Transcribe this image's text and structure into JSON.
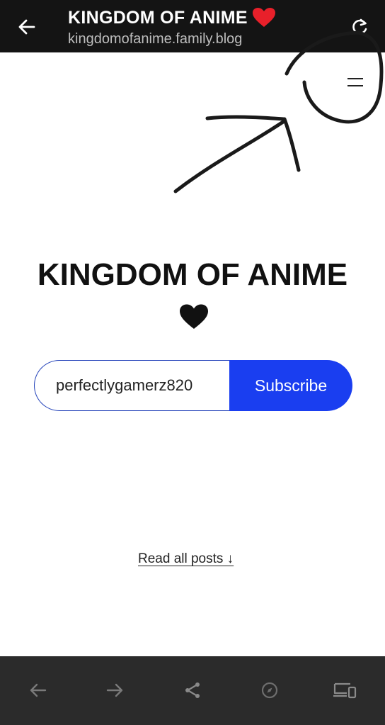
{
  "browser": {
    "title": "KINGDOM OF ANIME",
    "url": "kingdomofanime.family.blog"
  },
  "blog": {
    "title": "KINGDOM OF ANIME"
  },
  "subscribe": {
    "email_value": "perfectlygamerz820",
    "button_label": "Subscribe"
  },
  "read_all": {
    "label": "Read all posts ↓"
  },
  "colors": {
    "topbar": "#141414",
    "bottombar": "#2b2b2b",
    "subscribe_blue": "#1a3ef0",
    "heart_red": "#e8202a"
  },
  "icons": {
    "back": "arrow-left-icon",
    "reload": "reload-icon",
    "menu": "hamburger-menu-icon",
    "nav_back": "nav-back-icon",
    "nav_forward": "nav-forward-icon",
    "share": "share-icon",
    "compass": "compass-icon",
    "devices": "devices-icon"
  }
}
